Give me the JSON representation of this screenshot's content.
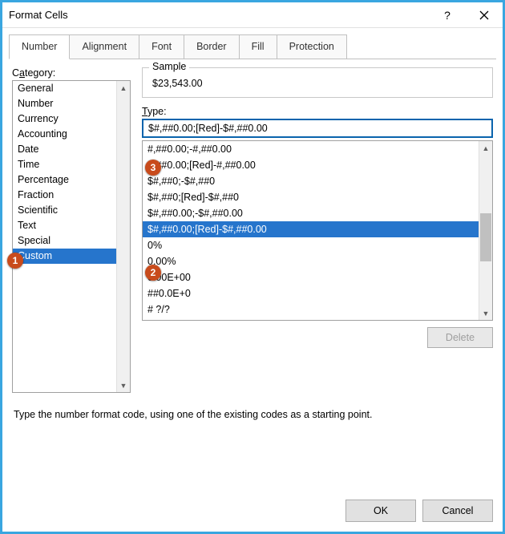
{
  "window": {
    "title": "Format Cells",
    "help": "?",
    "close": "✕"
  },
  "tabs": {
    "items": [
      {
        "label": "Number",
        "active": true
      },
      {
        "label": "Alignment"
      },
      {
        "label": "Font"
      },
      {
        "label": "Border"
      },
      {
        "label": "Fill"
      },
      {
        "label": "Protection"
      }
    ]
  },
  "category": {
    "label_pre": "C",
    "label_u": "a",
    "label_post": "tegory:",
    "items": [
      "General",
      "Number",
      "Currency",
      "Accounting",
      "Date",
      "Time",
      "Percentage",
      "Fraction",
      "Scientific",
      "Text",
      "Special",
      "Custom"
    ],
    "selected_index": 11
  },
  "sample": {
    "label": "Sample",
    "value": "$23,543.00"
  },
  "type": {
    "label_u": "T",
    "label_post": "ype:",
    "value": "$#,##0.00;[Red]-$#,##0.00",
    "options": [
      "#,##0.00;-#,##0.00",
      "#,##0.00;[Red]-#,##0.00",
      "$#,##0;-$#,##0",
      "$#,##0;[Red]-$#,##0",
      "$#,##0.00;-$#,##0.00",
      "$#,##0.00;[Red]-$#,##0.00",
      "0%",
      "0.00%",
      "0.00E+00",
      "##0.0E+0",
      "# ?/?"
    ],
    "selected_index": 5
  },
  "buttons": {
    "delete": "Delete",
    "ok": "OK",
    "cancel": "Cancel"
  },
  "hint": "Type the number format code, using one of the existing codes as a starting point.",
  "callouts": {
    "c1": "1",
    "c2": "2",
    "c3": "3"
  }
}
